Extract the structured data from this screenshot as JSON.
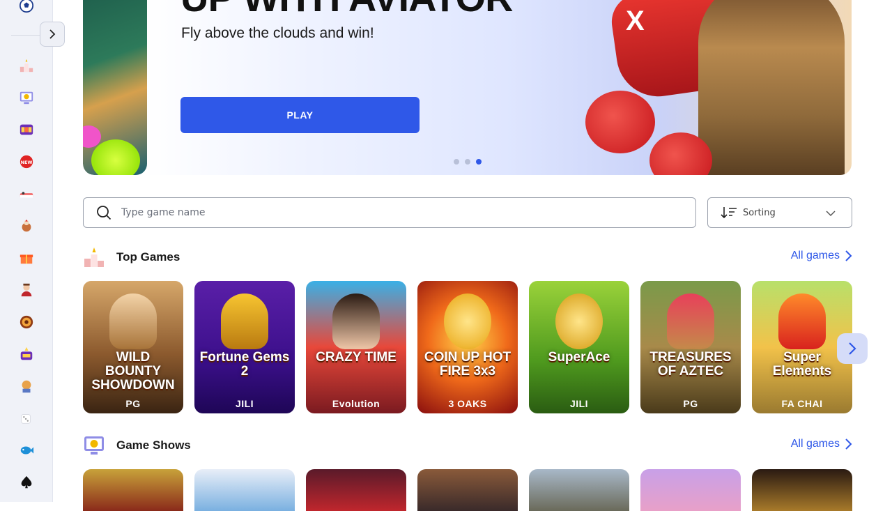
{
  "sidebar": {
    "toggle_label": ">",
    "items": [
      {
        "name": "sport",
        "icon": "soccer-ball-icon"
      },
      {
        "name": "top-games",
        "icon": "podium-icon"
      },
      {
        "name": "game-shows",
        "icon": "monitor-dollar-icon"
      },
      {
        "name": "slots",
        "icon": "slot-machine-icon"
      },
      {
        "name": "new",
        "icon": "new-badge-icon"
      },
      {
        "name": "crash",
        "icon": "arcade-icon"
      },
      {
        "name": "chicken",
        "icon": "chicken-icon"
      },
      {
        "name": "bonus",
        "icon": "gift-icon"
      },
      {
        "name": "live-dealers",
        "icon": "dealer-icon"
      },
      {
        "name": "roulette",
        "icon": "roulette-icon"
      },
      {
        "name": "jackpot",
        "icon": "jackpot-icon"
      },
      {
        "name": "bingo",
        "icon": "bingo-icon"
      },
      {
        "name": "dice",
        "icon": "dice-icon"
      },
      {
        "name": "fishing",
        "icon": "fish-icon"
      },
      {
        "name": "cards",
        "icon": "spade-icon"
      }
    ]
  },
  "banner": {
    "heading": "UP WITH AVIATOR",
    "subtitle": "Fly above the clouds and win!",
    "button_label": "PLAY",
    "active_slide": 3,
    "slides": 3
  },
  "search": {
    "placeholder": "Type game name",
    "value": ""
  },
  "sorting": {
    "label": "Sorting"
  },
  "sections": [
    {
      "title": "Top Games",
      "link": "All games",
      "games": [
        {
          "title": "WILD BOUNTY SHOWDOWN",
          "provider": "PG"
        },
        {
          "title": "Fortune Gems 2",
          "provider": "JILI"
        },
        {
          "title": "CRAZY TIME",
          "provider": "Evolution"
        },
        {
          "title": "COIN UP HOT FIRE 3x3",
          "provider": "3 OAKS"
        },
        {
          "title": "SuperAce",
          "provider": "JILI"
        },
        {
          "title": "TREASURES OF AZTEC",
          "provider": "PG"
        },
        {
          "title": "Super Elements",
          "provider": "FA CHAI"
        }
      ]
    },
    {
      "title": "Game Shows",
      "link": "All games"
    }
  ]
}
